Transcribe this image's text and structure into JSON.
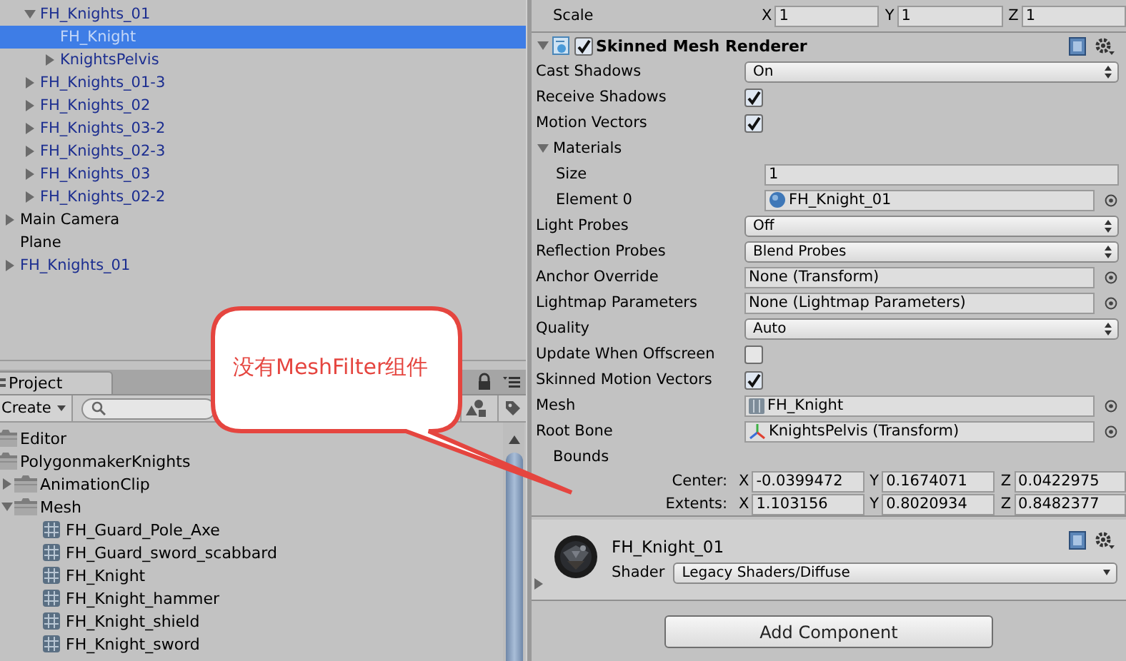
{
  "hierarchy": {
    "nested_items": [
      {
        "label": "FH_Knights_01",
        "prefab": true,
        "expanded": true,
        "selected": false,
        "children": [
          {
            "label": "FH_Knight",
            "prefab": true,
            "selected": true
          },
          {
            "label": "KnightsPelvis",
            "prefab": true,
            "expanded": false,
            "selected": false
          }
        ]
      },
      {
        "label": "FH_Knights_01-3",
        "prefab": true,
        "expanded": false,
        "selected": false
      },
      {
        "label": "FH_Knights_02",
        "prefab": true,
        "expanded": false,
        "selected": false
      },
      {
        "label": "FH_Knights_03-2",
        "prefab": true,
        "expanded": false,
        "selected": false
      },
      {
        "label": "FH_Knights_02-3",
        "prefab": true,
        "expanded": false,
        "selected": false
      },
      {
        "label": "FH_Knights_03",
        "prefab": true,
        "expanded": false,
        "selected": false
      },
      {
        "label": "FH_Knights_02-2",
        "prefab": true,
        "expanded": false,
        "selected": false
      }
    ],
    "root_items": [
      {
        "label": "Main Camera",
        "prefab": false,
        "expanded": false,
        "selected": false
      },
      {
        "label": "Plane",
        "prefab": false,
        "selected": false
      },
      {
        "label": "FH_Knights_01",
        "prefab": true,
        "expanded": false,
        "selected": false
      }
    ]
  },
  "project": {
    "tab": "Project",
    "create_button": "Create",
    "items": [
      {
        "label": "Editor",
        "kind": "folder"
      },
      {
        "label": "PolygonmakerKnights",
        "kind": "folder",
        "children": [
          {
            "label": "AnimationClip",
            "kind": "folder",
            "expanded": false
          },
          {
            "label": "Mesh",
            "kind": "folder",
            "expanded": true,
            "children": [
              {
                "label": "FH_Guard_Pole_Axe",
                "kind": "mesh"
              },
              {
                "label": "FH_Guard_sword_scabbard",
                "kind": "mesh"
              },
              {
                "label": "FH_Knight",
                "kind": "mesh"
              },
              {
                "label": "FH_Knight_hammer",
                "kind": "mesh"
              },
              {
                "label": "FH_Knight_shield",
                "kind": "mesh"
              },
              {
                "label": "FH_Knight_sword",
                "kind": "mesh"
              }
            ]
          }
        ]
      }
    ]
  },
  "inspector": {
    "scale": {
      "label": "Scale",
      "components": [
        {
          "axis": "X",
          "value": "1"
        },
        {
          "axis": "Y",
          "value": "1"
        },
        {
          "axis": "Z",
          "value": "1"
        }
      ]
    },
    "component": {
      "title": "Skinned Mesh Renderer",
      "enabled": true,
      "expanded": true,
      "properties": [
        {
          "kind": "dropdown",
          "label": "Cast Shadows",
          "value": "On"
        },
        {
          "kind": "checkbox",
          "label": "Receive Shadows",
          "checked": true
        },
        {
          "kind": "checkbox",
          "label": "Motion Vectors",
          "checked": true
        },
        {
          "kind": "section",
          "label": "Materials",
          "expanded": true,
          "children": [
            {
              "kind": "text",
              "label": "Size",
              "value": "1"
            },
            {
              "kind": "material",
              "label": "Element 0",
              "value": "FH_Knight_01"
            }
          ]
        },
        {
          "kind": "dropdown",
          "label": "Light Probes",
          "value": "Off"
        },
        {
          "kind": "dropdown",
          "label": "Reflection Probes",
          "value": "Blend Probes"
        },
        {
          "kind": "object",
          "label": "Anchor Override",
          "value": "None (Transform)"
        },
        {
          "kind": "object",
          "label": "Lightmap Parameters",
          "value": "None (Lightmap Parameters)"
        },
        {
          "kind": "dropdown",
          "label": "Quality",
          "value": "Auto"
        },
        {
          "kind": "checkbox",
          "label": "Update When Offscreen",
          "checked": false
        },
        {
          "kind": "checkbox",
          "label": "Skinned Motion Vectors",
          "checked": true
        },
        {
          "kind": "mesh",
          "label": "Mesh",
          "value": "FH_Knight"
        },
        {
          "kind": "transform",
          "label": "Root Bone",
          "value": "KnightsPelvis (Transform)"
        },
        {
          "kind": "section",
          "label": "Bounds",
          "children": [
            {
              "kind": "vector",
              "label": "Center:",
              "components": [
                {
                  "axis": "X",
                  "value": "-0.0399472"
                },
                {
                  "axis": "Y",
                  "value": "0.1674071"
                },
                {
                  "axis": "Z",
                  "value": "0.0422975"
                }
              ]
            },
            {
              "kind": "vector",
              "label": "Extents:",
              "components": [
                {
                  "axis": "X",
                  "value": "1.103156"
                },
                {
                  "axis": "Y",
                  "value": "0.8020934"
                },
                {
                  "axis": "Z",
                  "value": "0.8482377"
                }
              ]
            }
          ]
        }
      ]
    },
    "material": {
      "name": "FH_Knight_01",
      "shader_label": "Shader",
      "shader": "Legacy Shaders/Diffuse",
      "expanded": false
    },
    "add_button": "Add Component"
  },
  "callout": {
    "text": "没有MeshFilter组件"
  }
}
